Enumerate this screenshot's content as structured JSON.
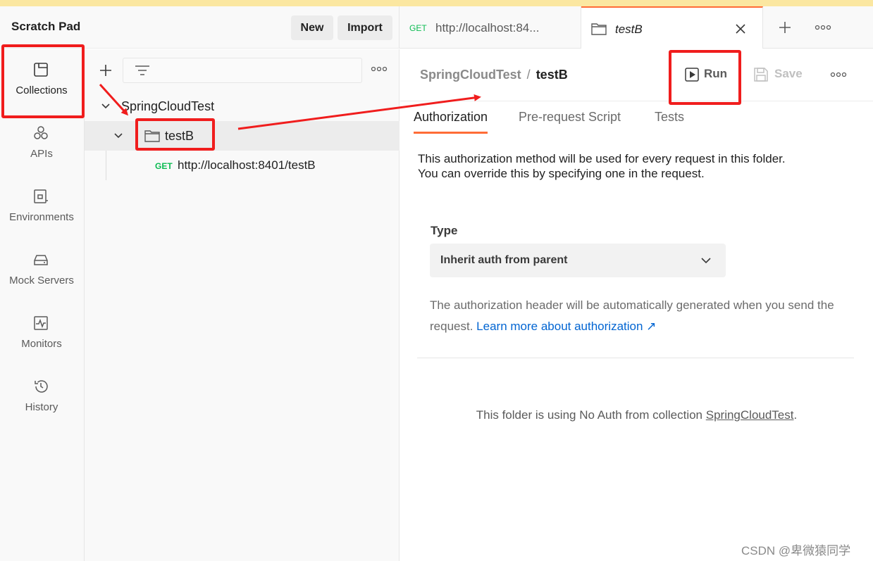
{
  "app": {
    "title": "Scratch Pad"
  },
  "header": {
    "new_label": "New",
    "import_label": "Import"
  },
  "sidebar": {
    "items": [
      {
        "label": "Collections",
        "icon": "collections-icon",
        "active": true
      },
      {
        "label": "APIs",
        "icon": "apis-icon"
      },
      {
        "label": "Environments",
        "icon": "environments-icon"
      },
      {
        "label": "Mock Servers",
        "icon": "mock-servers-icon"
      },
      {
        "label": "Monitors",
        "icon": "monitors-icon"
      },
      {
        "label": "History",
        "icon": "history-icon"
      }
    ]
  },
  "tree": {
    "collection_name": "SpringCloudTest",
    "folder_name": "testB",
    "request": {
      "method": "GET",
      "url": "http://localhost:8401/testB"
    }
  },
  "tabs": [
    {
      "method": "GET",
      "title": "http://localhost:84..."
    },
    {
      "title": "testB",
      "active": true
    }
  ],
  "main": {
    "breadcrumb": {
      "parent": "SpringCloudTest",
      "separator": "/",
      "current": "testB"
    },
    "run_label": "Run",
    "save_label": "Save",
    "subtabs": [
      "Authorization",
      "Pre-request Script",
      "Tests"
    ],
    "description_line1": "This authorization method will be used for every request in this folder.",
    "description_line2": "You can override this by specifying one in the request.",
    "type_label": "Type",
    "type_value": "Inherit auth from parent",
    "help_text": "The authorization header will be automatically generated when you send the request.",
    "help_link": "Learn more about authorization ↗",
    "note_prefix": "This folder is using No Auth from collection",
    "note_link": "SpringCloudTest",
    "note_suffix": "."
  },
  "watermark": "CSDN @卑微猿同学",
  "colors": {
    "accent": "#ff6c37",
    "get": "#0cbb52",
    "link": "#0265d2",
    "annotation": "#f01d1d"
  }
}
